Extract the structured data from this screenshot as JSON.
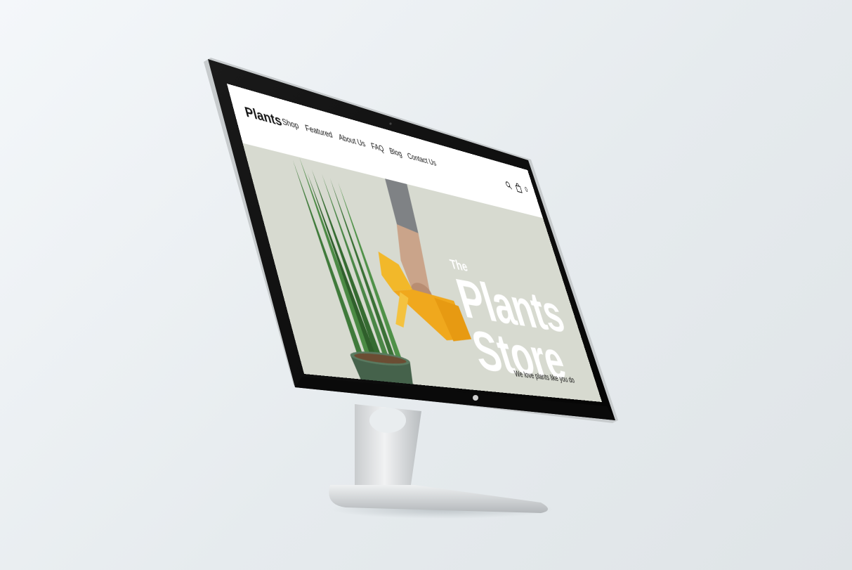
{
  "header": {
    "brand": "Plants",
    "nav": [
      "Shop",
      "Featured",
      "About Us",
      "FAQ",
      "Blog",
      "Contact Us"
    ],
    "icons": [
      "search-icon",
      "bag-icon"
    ],
    "cart_count": "0"
  },
  "hero": {
    "title_small": "The",
    "title_line1": "Plants",
    "title_line2": "Store",
    "subtitle": "We love plants like you do"
  },
  "colors": {
    "hero_bg": "#d7dad0",
    "accent_yellow": "#f2b82a",
    "plant_green": "#3f7a3a",
    "bezel": "#0b0b0b"
  }
}
